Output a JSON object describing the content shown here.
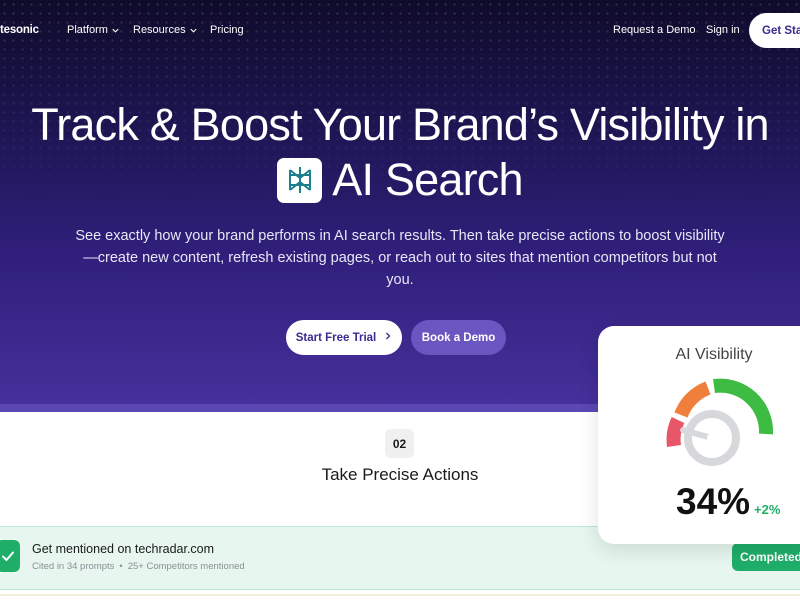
{
  "nav": {
    "logo": "tesonic",
    "platform": "Platform",
    "resources": "Resources",
    "pricing": "Pricing",
    "request_demo": "Request a Demo",
    "sign_in": "Sign in",
    "get_started": "Get Sta"
  },
  "hero": {
    "title_line1": "Track & Boost Your Brand’s Visibility in",
    "title_line2": "AI Search",
    "subtitle": "See exactly how your brand performs in AI search results. Then take precise actions to boost visibility—create new content, refresh existing pages, or reach out to sites that mention competitors but not you.",
    "cta_primary": "Start Free Trial",
    "cta_secondary": "Book a Demo"
  },
  "step": {
    "number": "02",
    "title": "Take Precise Actions"
  },
  "action": {
    "title": "Get mentioned on techradar.com",
    "cited": "Cited in 34 prompts",
    "separator": "•",
    "competitors": "25+ Competitors mentioned",
    "status": "Completed"
  },
  "visibility": {
    "title": "AI Visibility",
    "value": "34%",
    "delta": "+2%",
    "level": 0.34
  },
  "colors": {
    "hero_top": "#0f0b2a",
    "hero_bottom": "#46309b",
    "accent_purple": "#3b2a8f",
    "success_green": "#1fae6a",
    "gauge_red": "#e8566a",
    "gauge_orange": "#f07f3c",
    "gauge_green": "#3dbb42"
  }
}
